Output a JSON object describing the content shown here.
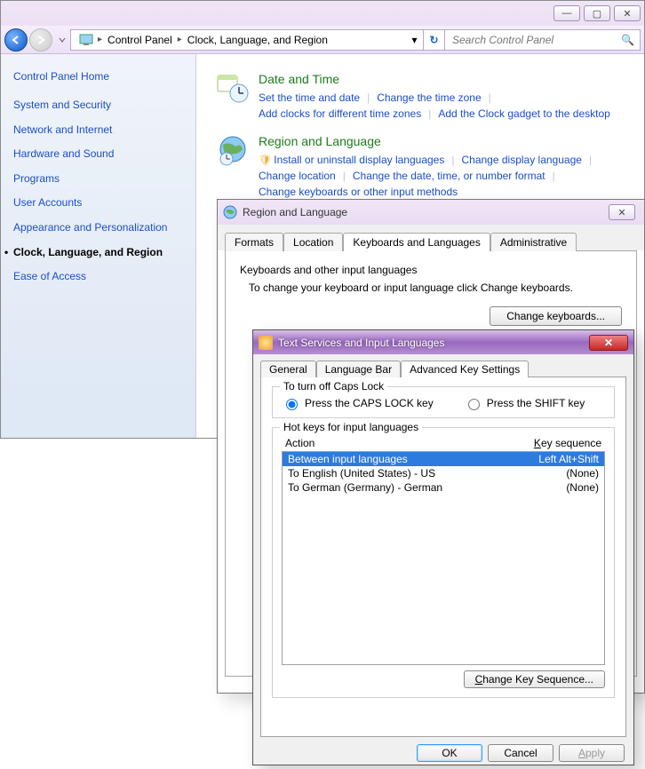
{
  "window": {
    "breadcrumb": [
      "Control Panel",
      "Clock, Language, and Region"
    ],
    "search_placeholder": "Search Control Panel"
  },
  "sidebar": {
    "home": "Control Panel Home",
    "items": [
      "System and Security",
      "Network and Internet",
      "Hardware and Sound",
      "Programs",
      "User Accounts",
      "Appearance and Personalization",
      "Clock, Language, and Region",
      "Ease of Access"
    ],
    "current_index": 6
  },
  "main": {
    "categories": [
      {
        "title": "Date and Time",
        "links": [
          "Set the time and date",
          "Change the time zone",
          "Add clocks for different time zones",
          "Add the Clock gadget to the desktop"
        ]
      },
      {
        "title": "Region and Language",
        "shield_link": "Install or uninstall display languages",
        "links": [
          "Change display language",
          "Change location",
          "Change the date, time, or number format",
          "Change keyboards or other input methods"
        ]
      }
    ]
  },
  "region_dialog": {
    "title": "Region and Language",
    "tabs": [
      "Formats",
      "Location",
      "Keyboards and Languages",
      "Administrative"
    ],
    "active_tab": 2,
    "group_heading": "Keyboards and other input languages",
    "group_text": "To change your keyboard or input language click Change keyboards.",
    "button": "Change keyboards..."
  },
  "ts_dialog": {
    "title": "Text Services and Input Languages",
    "tabs": [
      "General",
      "Language Bar",
      "Advanced Key Settings"
    ],
    "active_tab": 2,
    "capslock": {
      "legend": "To turn off Caps Lock",
      "opt1": "Press the CAPS LOCK key",
      "opt2": "Press the SHIFT key",
      "selected": 0
    },
    "hotkeys": {
      "legend": "Hot keys for input languages",
      "col_action": "Action",
      "col_keyseq": "Key sequence",
      "rows": [
        {
          "action": "Between input languages",
          "seq": "Left Alt+Shift"
        },
        {
          "action": "To English (United States) - US",
          "seq": "(None)"
        },
        {
          "action": "To German (Germany) - German",
          "seq": "(None)"
        }
      ],
      "selected": 0,
      "button": "Change Key Sequence..."
    },
    "buttons": {
      "ok": "OK",
      "cancel": "Cancel",
      "apply": "Apply"
    }
  }
}
